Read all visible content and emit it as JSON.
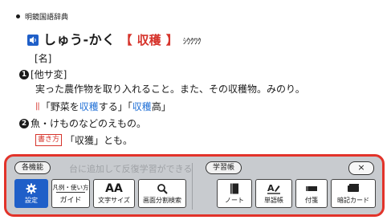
{
  "dictionary": {
    "source": "明鏡国語辞典",
    "headword": "しゅう-かく",
    "kanji": "収穫",
    "bracket_open": "【",
    "bracket_close】": "】",
    "reading_kana": "ｼｳｸﾜｸ",
    "pos": "[名]",
    "sense1_num": "1",
    "sense1_label": "[他サ変]",
    "sense1_def": "実った農作物を取り入れること。また、その収穫物。みのり。",
    "example": {
      "mark": "||",
      "q1": "「野菜を",
      "w1": "収穫",
      "q2": "する」「",
      "w2": "収穫",
      "q3": "高」"
    },
    "sense2_num": "2",
    "sense2_def": "魚・けものなどのえもの。",
    "alt_label": "書き方",
    "alt_text": "「収獲」とも。"
  },
  "toolbar": {
    "group1_label": "各機能",
    "group2_label": "学習帳",
    "ghost_text": "台に追加して反復学習ができる",
    "close_label": "×",
    "buttons": {
      "settings": "設定",
      "guide_top": "凡例・使い方",
      "guide": "ガイド",
      "font_size": "文字サイズ",
      "font_glyph": "AA",
      "split_search": "画面分割検索",
      "note": "ノート",
      "vocab": "単語帳",
      "sticky": "付箋",
      "memory_card": "暗記カード"
    }
  },
  "colors": {
    "accent_red": "#e2332a",
    "link_blue": "#1f6fd6",
    "active_blue": "#1f5fc8",
    "toolbar_bg": "#c8cbcf"
  }
}
